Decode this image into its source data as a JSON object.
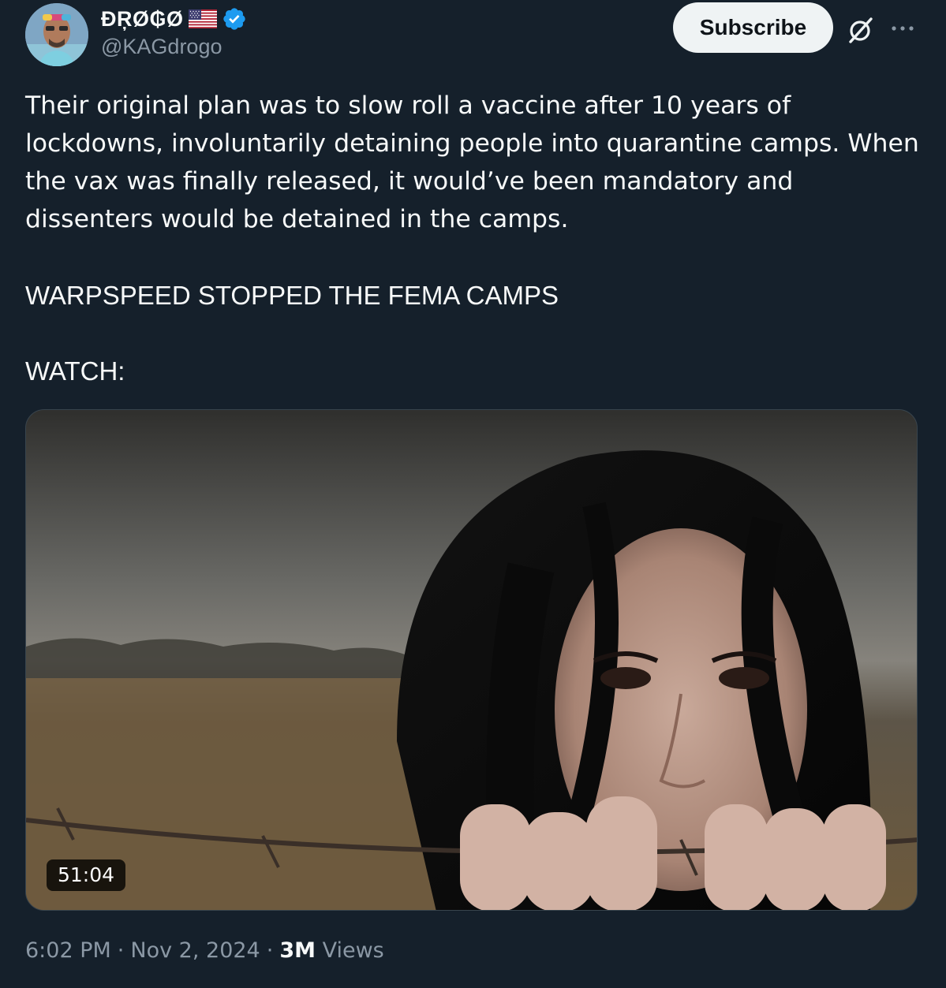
{
  "author": {
    "display_name": "ĐŖØ₲Ø",
    "handle": "@KAGdrogo",
    "flag_icon": "us-flag-icon",
    "verified_icon": "verified-badge-icon",
    "verified_color": "#1d9bf0"
  },
  "header_actions": {
    "subscribe_label": "Subscribe",
    "grok_icon": "grok-icon",
    "more_icon": "more-icon"
  },
  "post": {
    "paragraph_1": "Their original plan was to slow roll a vaccine after 10 years of lockdowns, involuntarily detaining people into quarantine camps. When the vax was finally released, it would’ve been mandatory and dissenters would be detained in the camps.",
    "paragraph_2": "WARPSPEED STOPPED THE FEMA CAMPS",
    "paragraph_3": "WATCH:"
  },
  "media": {
    "type": "video",
    "duration": "51:04"
  },
  "meta": {
    "time": "6:02 PM",
    "separator_1": "·",
    "date": "Nov 2, 2024",
    "separator_2": "·",
    "views_count": "3M",
    "views_label": "Views"
  },
  "colors": {
    "background": "#15202b",
    "text_primary": "#f7f9f9",
    "text_secondary": "#8b98a5",
    "button_bg": "#eff3f4",
    "button_text": "#0f1419"
  }
}
